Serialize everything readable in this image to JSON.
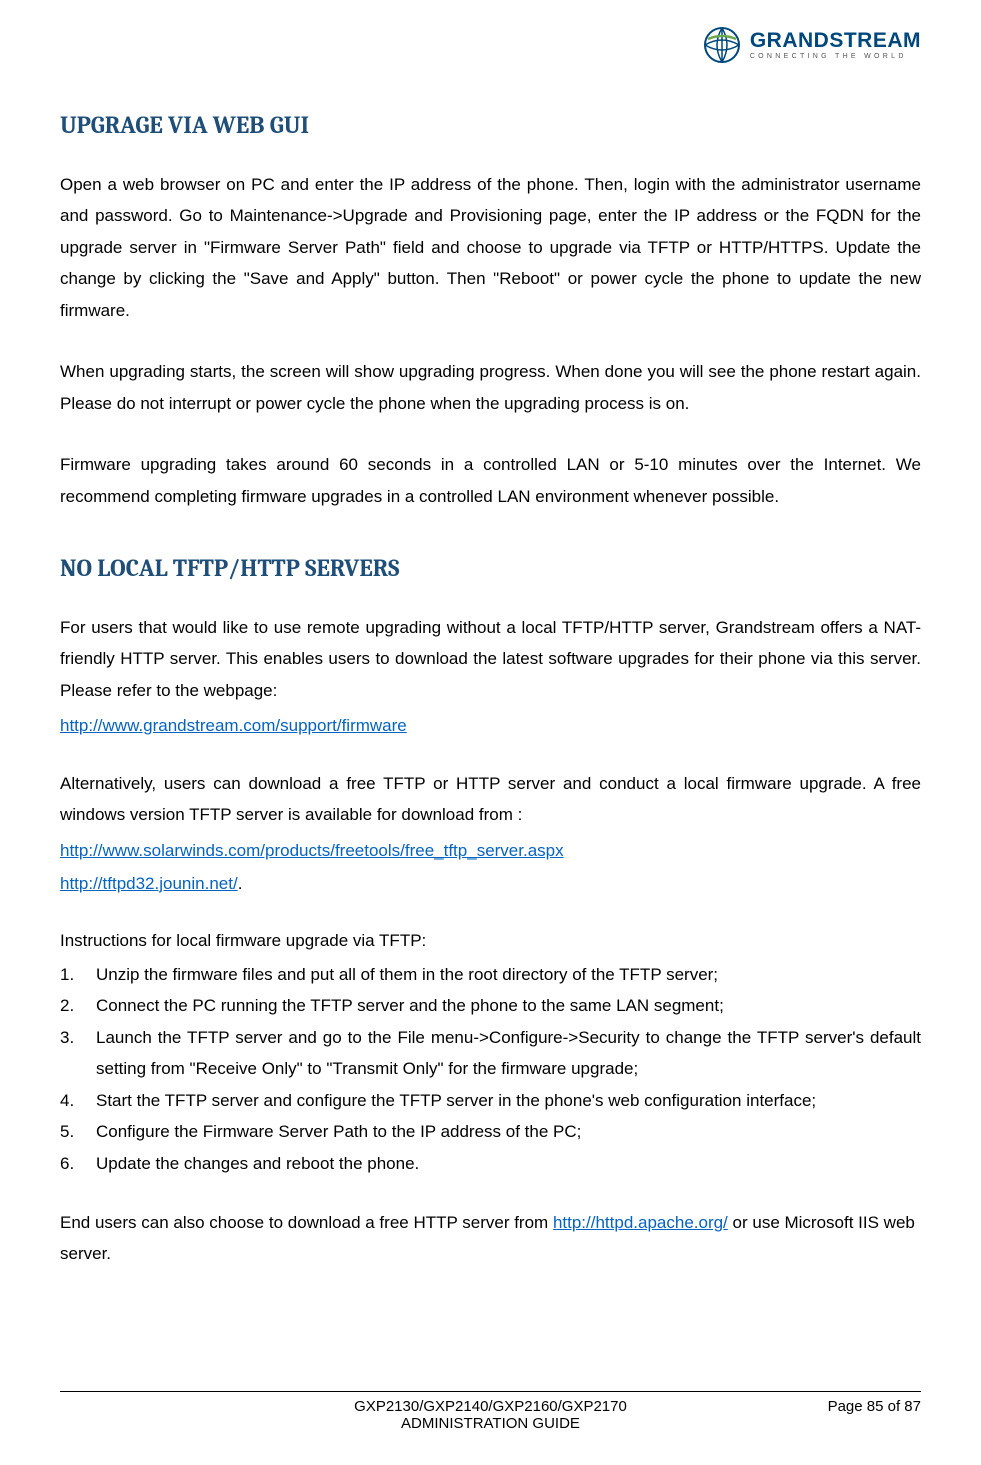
{
  "header": {
    "brand": "GRANDSTREAM",
    "tagline": "CONNECTING THE WORLD"
  },
  "s1": {
    "title": "UPGRAGE VIA WEB GUI",
    "p1": "Open a web browser on PC and enter the IP address of the phone. Then, login with the administrator username and password. Go to Maintenance->Upgrade and Provisioning page, enter the IP address or the FQDN for the upgrade server in \"Firmware Server Path\" field and choose to upgrade via TFTP or HTTP/HTTPS. Update the change by clicking the \"Save and Apply\" button. Then \"Reboot\" or power cycle the phone to update the new firmware.",
    "p2": "When upgrading starts, the screen will show upgrading progress. When done you will see the phone restart again. Please do not interrupt or power cycle the phone when the upgrading process is on.",
    "p3": "Firmware upgrading takes around 60 seconds in a controlled LAN or 5-10 minutes over the Internet. We recommend completing firmware upgrades in a controlled LAN environment whenever possible."
  },
  "s2": {
    "title": "NO LOCAL TFTP/HTTP SERVERS",
    "p1": "For users that would like to use remote upgrading without a local TFTP/HTTP server, Grandstream offers a NAT-friendly HTTP server. This enables users to download the latest software upgrades for their phone via this server. Please refer to the webpage:",
    "link1": "http://www.grandstream.com/support/firmware",
    "p2": "Alternatively, users can download a free TFTP or HTTP server and conduct a local firmware upgrade. A free windows version TFTP server is available for download from :",
    "link2": "http://www.solarwinds.com/products/freetools/free_tftp_server.aspx",
    "link3": "http://tftpd32.jounin.net/",
    "link3_suffix": ".",
    "list_intro": "Instructions for local firmware upgrade via TFTP:",
    "items": [
      "Unzip the firmware files and put all of them in the root directory of the TFTP server;",
      "Connect the PC running the TFTP server and the phone to the same LAN segment;",
      "Launch the TFTP server and go to the File menu->Configure->Security to change the TFTP server's default setting from \"Receive Only\" to \"Transmit Only\" for the firmware upgrade;",
      "Start the TFTP server and configure the TFTP server in the phone's web configuration interface;",
      "Configure the Firmware Server Path to the IP address of the PC;",
      "Update the changes and reboot the phone."
    ],
    "end_pre": "End users can also choose to download a free HTTP server from ",
    "end_link": "http://httpd.apache.org/",
    "end_post": " or use Microsoft IIS web server."
  },
  "footer": {
    "center1": "GXP2130/GXP2140/GXP2160/GXP2170",
    "center2": "ADMINISTRATION GUIDE",
    "right": "Page 85 of 87"
  }
}
